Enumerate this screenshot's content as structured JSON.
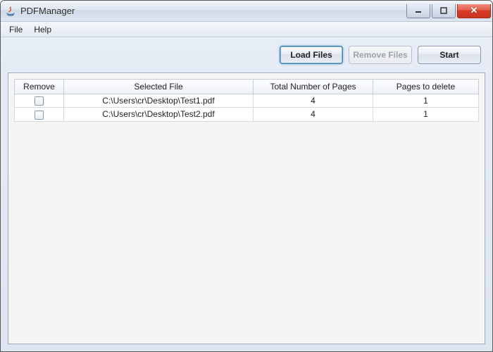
{
  "window": {
    "title": "PDFManager"
  },
  "menubar": {
    "file": "File",
    "help": "Help"
  },
  "toolbar": {
    "load_files": "Load Files",
    "remove_files": "Remove Files",
    "start": "Start"
  },
  "table": {
    "headers": {
      "remove": "Remove",
      "selected_file": "Selected File",
      "total_pages": "Total Number of Pages",
      "pages_to_delete": "Pages to delete"
    },
    "rows": [
      {
        "remove_checked": false,
        "file": "C:\\Users\\cr\\Desktop\\Test1.pdf",
        "total_pages": "4",
        "pages_to_delete": "1"
      },
      {
        "remove_checked": false,
        "file": "C:\\Users\\cr\\Desktop\\Test2.pdf",
        "total_pages": "4",
        "pages_to_delete": "1"
      }
    ]
  }
}
